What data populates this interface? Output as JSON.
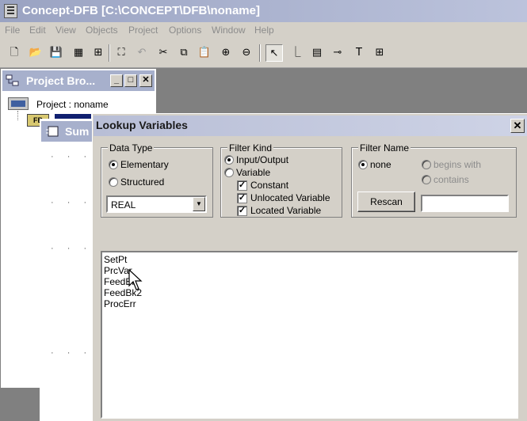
{
  "app": {
    "title": "Concept-DFB [C:\\CONCEPT\\DFB\\noname]"
  },
  "menu": [
    "File",
    "Edit",
    "View",
    "Objects",
    "Project",
    "Options",
    "Window",
    "Help"
  ],
  "toolbar": {
    "icons": [
      "new-file-icon",
      "open-folder-icon",
      "save-icon",
      "properties-icon",
      "tree-icon",
      "find-icon",
      "undo-icon",
      "cut-icon",
      "copy-icon",
      "paste-icon",
      "zoom-in-icon",
      "zoom-out-icon",
      "select-pointer-icon",
      "link-icon",
      "ftb-icon",
      "pin-icon",
      "text-icon",
      "grid-icon"
    ]
  },
  "project_browser": {
    "title": "Project Bro...",
    "project_label": "Project : noname",
    "fb_node": "FB"
  },
  "sum_window": {
    "title": "Sum"
  },
  "dialog": {
    "title": "Lookup Variables",
    "close_glyph": "✕",
    "data_type": {
      "label": "Data Type",
      "options": [
        "Elementary",
        "Structured"
      ],
      "selected": "Elementary",
      "select_value": "REAL"
    },
    "filter_kind": {
      "label": "Filter Kind",
      "radios": [
        "Input/Output",
        "Variable"
      ],
      "selected": "Input/Output",
      "checks": [
        "Constant",
        "Unlocated Variable",
        "Located Variable"
      ]
    },
    "filter_name": {
      "label": "Filter Name",
      "radios": [
        "none",
        "begins with",
        "contains"
      ],
      "selected": "none",
      "rescan": "Rescan",
      "input_value": ""
    },
    "variables": [
      "SetPt",
      "PrcVar",
      "FeedBk",
      "FeedBk2",
      "ProcErr"
    ]
  }
}
